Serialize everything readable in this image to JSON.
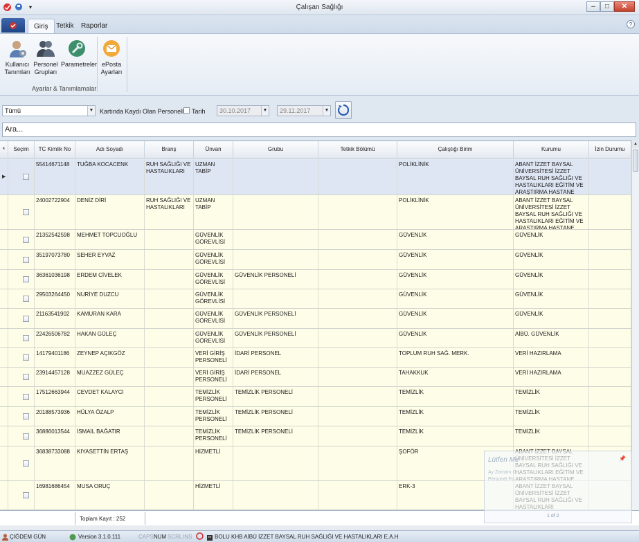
{
  "window": {
    "title": "Çalışan Sağlığı",
    "min_label": "–",
    "max_label": "□",
    "close_label": "✕"
  },
  "tabs": [
    {
      "label": "Giriş"
    },
    {
      "label": "Tetkik"
    },
    {
      "label": "Raporlar"
    }
  ],
  "ribbon": {
    "buttons": [
      {
        "label1": "Kullanıcı",
        "label2": "Tanımları",
        "icon": "user-settings-icon"
      },
      {
        "label1": "Personel",
        "label2": "Grupları",
        "icon": "people-icon"
      },
      {
        "label1": "Parametreler",
        "label2": "",
        "icon": "wrench-icon"
      },
      {
        "label1": "ePosta",
        "label2": "Ayarları",
        "icon": "email-icon"
      }
    ],
    "group_label": "Ayarlar & Tanımlamalar"
  },
  "filters": {
    "type_value": "Tümü",
    "card_label": "Kartında Kaydı Olan Personeller",
    "date_label": "Tarih",
    "date_from": "30.10.2017",
    "date_to": "29.11.2017"
  },
  "search": {
    "value": "Ara..."
  },
  "grid": {
    "columns": [
      "Seçim",
      "TC Kimlik No",
      "Adı Soyadı",
      "Branş",
      "Ünvan",
      "Grubu",
      "Tetkik Bölümü",
      "Çalıştığı Birim",
      "Kurumu",
      "İzin Durumu"
    ],
    "rows": [
      {
        "tc": "55414671148",
        "ad": "TUĞBA KOCACENK",
        "brans": "RUH SAĞLIĞI VE HASTALIKLARI",
        "unvan": "UZMAN TABİP",
        "grubu": "",
        "tetkik": "",
        "birim": "POLİKLİNİK",
        "kurum": "ABANT İZZET BAYSAL ÜNİVERSİTESİ İZZET BAYSAL RUH SAĞLIĞI VE HASTALIKLARI EĞİTİM VE ARAŞTIRMA HASTANE",
        "izin": ""
      },
      {
        "tc": "24002722904",
        "ad": "DENİZ DİRİ",
        "brans": "RUH SAĞLIĞI VE HASTALIKLARI",
        "unvan": "UZMAN TABİP",
        "grubu": "",
        "tetkik": "",
        "birim": "POLİKLİNİK",
        "kurum": "ABANT İZZET BAYSAL ÜNİVERSİTESİ İZZET BAYSAL RUH SAĞLIĞI VE HASTALIKLARI EĞİTİM VE ARAŞTIRMA HASTANE",
        "izin": ""
      },
      {
        "tc": "21352542598",
        "ad": "MEHMET TOPCUOĞLU",
        "brans": "",
        "unvan": "GÜVENLİK GÖREVLİSİ",
        "grubu": "",
        "tetkik": "",
        "birim": "GÜVENLİK",
        "kurum": "GÜVENLİK",
        "izin": ""
      },
      {
        "tc": "35197073780",
        "ad": "SEHER EYVAZ",
        "brans": "",
        "unvan": "GÜVENLİK GÖREVLİSİ",
        "grubu": "",
        "tetkik": "",
        "birim": "GÜVENLİK",
        "kurum": "GÜVENLİK",
        "izin": ""
      },
      {
        "tc": "36361036198",
        "ad": "ERDEM CİVELEK",
        "brans": "",
        "unvan": "GÜVENLİK GÖREVLİSİ",
        "grubu": "GÜVENLİK PERSONELİ",
        "tetkik": "",
        "birim": "GÜVENLİK",
        "kurum": "GÜVENLİK",
        "izin": ""
      },
      {
        "tc": "29503264450",
        "ad": "NURİYE DUZCU",
        "brans": "",
        "unvan": "GÜVENLİK GÖREVLİSİ",
        "grubu": "",
        "tetkik": "",
        "birim": "GÜVENLİK",
        "kurum": "GÜVENLİK",
        "izin": ""
      },
      {
        "tc": "21163541902",
        "ad": "KAMURAN KARA",
        "brans": "",
        "unvan": "GÜVENLİK GÖREVLİSİ",
        "grubu": "GÜVENLİK PERSONELİ",
        "tetkik": "",
        "birim": "GÜVENLİK",
        "kurum": "GÜVENLİK",
        "izin": ""
      },
      {
        "tc": "22426506782",
        "ad": "HAKAN GÜLEÇ",
        "brans": "",
        "unvan": "GÜVENLİK GÖREVLİSİ",
        "grubu": "GÜVENLİK PERSONELİ",
        "tetkik": "",
        "birim": "GÜVENLİK",
        "kurum": "AİBÜ. GÜVENLİK",
        "izin": ""
      },
      {
        "tc": "14179401186",
        "ad": "ZEYNEP AÇIKGÖZ",
        "brans": "",
        "unvan": "VERİ GİRİŞ PERSONELİ",
        "grubu": "İDARİ PERSONEL",
        "tetkik": "",
        "birim": "TOPLUM RUH SAĞ. MERK.",
        "kurum": "VERİ HAZIRLAMA",
        "izin": ""
      },
      {
        "tc": "23914457128",
        "ad": "MUAZZEZ GÜLEÇ",
        "brans": "",
        "unvan": "VERİ GİRİŞ PERSONELİ",
        "grubu": "İDARİ PERSONEL",
        "tetkik": "",
        "birim": "TAHAKKUK",
        "kurum": "VERİ HAZIRLAMA",
        "izin": ""
      },
      {
        "tc": "17512663944",
        "ad": "CEVDET KALAYCI",
        "brans": "",
        "unvan": "TEMİZLİK PERSONELİ",
        "grubu": "TEMİZLİK PERSONELİ",
        "tetkik": "",
        "birim": "TEMİZLİK",
        "kurum": "TEMİZLİK",
        "izin": ""
      },
      {
        "tc": "20188573936",
        "ad": "HÜLYA ÖZALP",
        "brans": "",
        "unvan": "TEMİZLİK PERSONELİ",
        "grubu": "TEMİZLİK PERSONELİ",
        "tetkik": "",
        "birim": "TEMİZLİK",
        "kurum": "TEMİZLİK",
        "izin": ""
      },
      {
        "tc": "36886013544",
        "ad": "İSMAİL BAĞATIR",
        "brans": "",
        "unvan": "TEMİZLİK PERSONELİ",
        "grubu": "TEMİZLİK PERSONELİ",
        "tetkik": "",
        "birim": "TEMİZLİK",
        "kurum": "TEMİZLİK",
        "izin": ""
      },
      {
        "tc": "36838733088",
        "ad": "KIYASETTİN ERTAŞ",
        "brans": "",
        "unvan": "HİZMETLİ",
        "grubu": "",
        "tetkik": "",
        "birim": "ŞOFÖR",
        "kurum": "ABANT İZZET BAYSAL ÜNİVERSİTESİ İZZET BAYSAL RUH SAĞLIĞI VE HASTALIKLARI EĞİTİM VE ARAŞTIRMA HASTANE",
        "izin": ""
      },
      {
        "tc": "16981686454",
        "ad": "MUSA ORUÇ",
        "brans": "",
        "unvan": "HİZMETLİ",
        "grubu": "",
        "tetkik": "",
        "birim": "ERK-3",
        "kurum": "ABANT İZZET BAYSAL ÜNİVERSİTESİ İZZET BAYSAL RUH SAĞLIĞI VE HASTALIKLARI",
        "izin": ""
      }
    ]
  },
  "footer": {
    "total": "Toplam Kayıt : 252"
  },
  "notification": {
    "title": "Lütfen Me",
    "line1": "Ay Zamanı G",
    "line2": "Personel Fo",
    "pager": "1 of 2"
  },
  "status": {
    "user": "ÇİĞDEM GÜN",
    "version": "Version 3.1.0.111",
    "caps": "CAPS",
    "num": "NUM",
    "scrl": "SCRL",
    "ins": "INS",
    "institution": "BOLU KHB AİBÜ İZZET BAYSAL RUH SAĞLIĞI VE HASTALIKLARI E.A.H"
  },
  "colors": {
    "row_bg": "#fefee8",
    "selected_row_bg": "#dfe6f3",
    "app_button": "#1f4585"
  }
}
